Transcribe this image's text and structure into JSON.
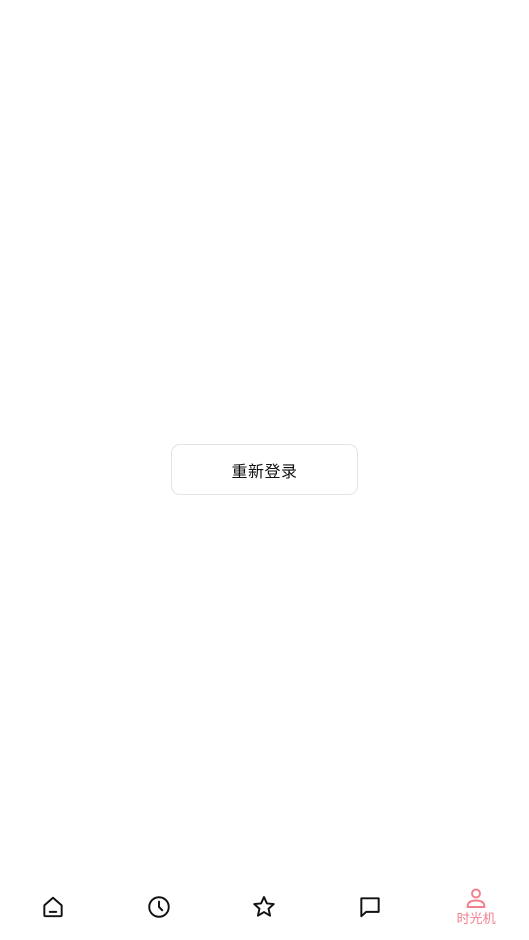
{
  "main": {
    "relogin_label": "重新登录"
  },
  "tabbar": {
    "active_color": "#f27f8c",
    "inactive_color": "#111111",
    "tabs": [
      {
        "icon": "home-icon",
        "label": ""
      },
      {
        "icon": "clock-icon",
        "label": ""
      },
      {
        "icon": "star-icon",
        "label": ""
      },
      {
        "icon": "message-icon",
        "label": ""
      },
      {
        "icon": "person-icon",
        "label": "时光机",
        "active": true
      }
    ]
  }
}
